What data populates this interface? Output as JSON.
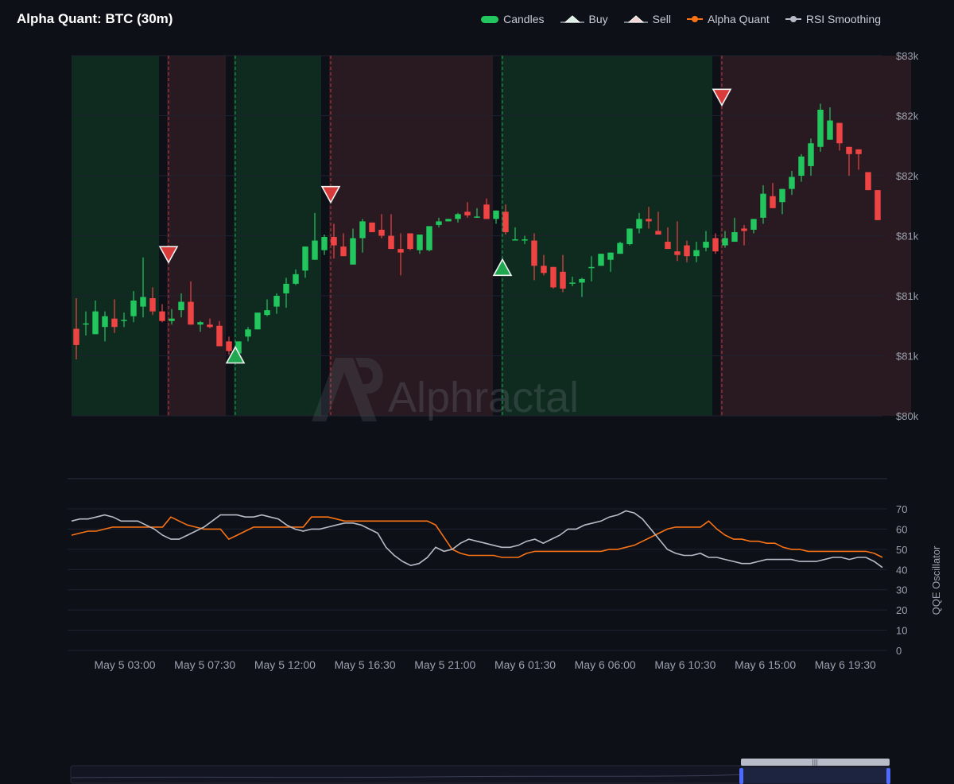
{
  "title": "Alpha Quant: BTC (30m)",
  "legend": [
    {
      "label": "Candles",
      "kind": "candle",
      "color": "#22c55e"
    },
    {
      "label": "Buy",
      "kind": "buy",
      "color": "#d7efe0"
    },
    {
      "label": "Sell",
      "kind": "sell",
      "color": "#f2d3d3"
    },
    {
      "label": "Alpha Quant",
      "kind": "line",
      "color": "#f97316"
    },
    {
      "label": "RSI Smoothing",
      "kind": "line",
      "color": "#b7bcc7"
    }
  ],
  "watermark": "Alphractal",
  "colors": {
    "up": "#22c55e",
    "down": "#ef4444",
    "bull_zone": "#0f2a1f",
    "bear_zone": "#281a20",
    "alpha_quant": "#f97316",
    "rsi": "#b7bcc7",
    "grid": "#1e2230",
    "axis_text": "#9aa0ad"
  },
  "chart_data": [
    {
      "type": "candlestick",
      "title": "Alpha Quant: BTC (30m)",
      "series": [
        {
          "name": "Candles"
        }
      ],
      "y_axis": {
        "min": 80000,
        "max": 83000,
        "ticks": [
          80000,
          80500,
          81000,
          81500,
          82000,
          82500,
          83000
        ],
        "tick_labels": [
          "$80k",
          "$81k",
          "$81k",
          "$81k",
          "$82k",
          "$82k",
          "$83k"
        ],
        "position": "right",
        "grid": true
      },
      "x_axis": {
        "tick_labels": [
          "May 5 03:00",
          "May 5 07:30",
          "May 5 12:00",
          "May 5 16:30",
          "May 5 21:00",
          "May 6 01:30",
          "May 6 06:00",
          "May 6 10:30",
          "May 6 15:00",
          "May 6 19:30"
        ]
      },
      "candles": [
        [
          80725,
          80980,
          80470,
          80590
        ],
        [
          80770,
          80870,
          80670,
          80770
        ],
        [
          80680,
          80960,
          80690,
          80870
        ],
        [
          80740,
          80870,
          80620,
          80830
        ],
        [
          80810,
          80970,
          80690,
          80740
        ],
        [
          80800,
          80860,
          80740,
          80800
        ],
        [
          80830,
          81040,
          80780,
          80960
        ],
        [
          80910,
          81320,
          80820,
          80990
        ],
        [
          80980,
          81070,
          80840,
          80870
        ],
        [
          80870,
          80930,
          80780,
          80790
        ],
        [
          80790,
          80890,
          80760,
          80810
        ],
        [
          80880,
          81020,
          80820,
          80950
        ],
        [
          80950,
          81120,
          80770,
          80760
        ],
        [
          80760,
          80790,
          80700,
          80780
        ],
        [
          80760,
          80810,
          80730,
          80740
        ],
        [
          80750,
          80790,
          80580,
          80580
        ],
        [
          80620,
          80660,
          80510,
          80540
        ],
        [
          80520,
          80620,
          80540,
          80620
        ],
        [
          80660,
          80740,
          80620,
          80720
        ],
        [
          80720,
          80840,
          80740,
          80860
        ],
        [
          80840,
          80970,
          80830,
          80880
        ],
        [
          80910,
          81020,
          80850,
          81000
        ],
        [
          81020,
          81150,
          80900,
          81100
        ],
        [
          81100,
          81220,
          81090,
          81180
        ],
        [
          81210,
          81360,
          81150,
          81410
        ],
        [
          81300,
          81690,
          81300,
          81460
        ],
        [
          81380,
          81510,
          81340,
          81490
        ],
        [
          81490,
          81600,
          81310,
          81420
        ],
        [
          81410,
          81520,
          81350,
          81330
        ],
        [
          81260,
          81560,
          81300,
          81480
        ],
        [
          81480,
          81640,
          81360,
          81620
        ],
        [
          81610,
          81600,
          81530,
          81530
        ],
        [
          81550,
          81680,
          81480,
          81500
        ],
        [
          81500,
          81680,
          81410,
          81390
        ],
        [
          81390,
          81520,
          81170,
          81360
        ],
        [
          81520,
          81490,
          81380,
          81390
        ],
        [
          81380,
          81510,
          81350,
          81510
        ],
        [
          81380,
          81520,
          81370,
          81580
        ],
        [
          81590,
          81650,
          81570,
          81620
        ],
        [
          81620,
          81560,
          81640,
          81640
        ],
        [
          81640,
          81690,
          81610,
          81680
        ],
        [
          81700,
          81780,
          81650,
          81670
        ],
        [
          81660,
          81730,
          81650,
          81660
        ],
        [
          81760,
          81810,
          81660,
          81640
        ],
        [
          81640,
          81690,
          81600,
          81710
        ],
        [
          81700,
          81760,
          81510,
          81530
        ],
        [
          81470,
          81570,
          81500,
          81470
        ],
        [
          81470,
          81500,
          81430,
          81470
        ],
        [
          81460,
          81520,
          81130,
          81250
        ],
        [
          81250,
          81340,
          81170,
          81190
        ],
        [
          81240,
          81070,
          81060,
          81070
        ],
        [
          81200,
          81340,
          81030,
          81060
        ],
        [
          81110,
          81160,
          81080,
          81110
        ],
        [
          81110,
          81150,
          80990,
          81140
        ],
        [
          81240,
          81330,
          81120,
          81240
        ],
        [
          81250,
          81320,
          81250,
          81350
        ],
        [
          81300,
          81330,
          81200,
          81360
        ],
        [
          81350,
          81450,
          81380,
          81440
        ],
        [
          81430,
          81510,
          81420,
          81560
        ],
        [
          81560,
          81690,
          81520,
          81640
        ],
        [
          81640,
          81740,
          81560,
          81620
        ],
        [
          81540,
          81700,
          81520,
          81510
        ],
        [
          81450,
          81570,
          81420,
          81390
        ],
        [
          81370,
          81620,
          81290,
          81340
        ],
        [
          81420,
          81460,
          81280,
          81330
        ],
        [
          81330,
          81450,
          81280,
          81380
        ],
        [
          81400,
          81540,
          81370,
          81450
        ],
        [
          81480,
          81520,
          81350,
          81370
        ],
        [
          81420,
          81540,
          81400,
          81480
        ],
        [
          81450,
          81650,
          81480,
          81530
        ],
        [
          81560,
          81590,
          81420,
          81540
        ],
        [
          81550,
          81590,
          81520,
          81640
        ],
        [
          81650,
          81920,
          81600,
          81850
        ],
        [
          81830,
          81940,
          81730,
          81730
        ],
        [
          81780,
          81880,
          81680,
          81890
        ],
        [
          81890,
          82040,
          81840,
          81990
        ],
        [
          82000,
          82180,
          81950,
          82160
        ],
        [
          82080,
          82310,
          82000,
          82270
        ],
        [
          82240,
          82600,
          82200,
          82550
        ],
        [
          82300,
          82570,
          82330,
          82460
        ],
        [
          82440,
          82360,
          82210,
          82270
        ],
        [
          82240,
          82200,
          82000,
          82180
        ],
        [
          82220,
          82100,
          82050,
          82180
        ],
        [
          82030,
          81840,
          81910,
          81880
        ],
        [
          81880,
          81820,
          81690,
          81630
        ]
      ],
      "signals": [
        {
          "type": "sell",
          "index": 10,
          "price": 81350
        },
        {
          "type": "buy",
          "index": 17,
          "price": 80500
        },
        {
          "type": "sell",
          "index": 27,
          "price": 81850
        },
        {
          "type": "buy",
          "index": 45,
          "price": 81230
        },
        {
          "type": "sell",
          "index": 68,
          "price": 82660
        }
      ],
      "zones": [
        {
          "kind": "bull",
          "from": 0,
          "to": 9
        },
        {
          "kind": "bear",
          "from": 10,
          "to": 16
        },
        {
          "kind": "bull",
          "from": 17,
          "to": 26
        },
        {
          "kind": "bear",
          "from": 27,
          "to": 44
        },
        {
          "kind": "bull",
          "from": 45,
          "to": 67
        },
        {
          "kind": "bear",
          "from": 68,
          "to": 87
        }
      ]
    },
    {
      "type": "line",
      "y_axis": {
        "label": "QQE Oscillator",
        "min": 0,
        "max": 70,
        "ticks": [
          0,
          10,
          20,
          30,
          40,
          50,
          60,
          70
        ],
        "grid": true,
        "position": "right"
      },
      "series": [
        {
          "name": "Alpha Quant",
          "color": "#f97316",
          "values": [
            57,
            58,
            59,
            59,
            60,
            61,
            61,
            61,
            61,
            61,
            61,
            61,
            66,
            64,
            62,
            61,
            60,
            60,
            60,
            55,
            57,
            59,
            61,
            61,
            61,
            61,
            61,
            61,
            61,
            66,
            66,
            66,
            65,
            64,
            64,
            64,
            64,
            64,
            64,
            64,
            64,
            64,
            64,
            64,
            62,
            56,
            50,
            48,
            47,
            47,
            47,
            47,
            46,
            46,
            46,
            48,
            49,
            49,
            49,
            49,
            49,
            49,
            49,
            49,
            49,
            50,
            50,
            51,
            52,
            54,
            56,
            58,
            60,
            61,
            61,
            61,
            61,
            64,
            60,
            57,
            55,
            55,
            54,
            54,
            53,
            53,
            51,
            50,
            50,
            49,
            49,
            49,
            49,
            49,
            49,
            49,
            49,
            48,
            46
          ]
        },
        {
          "name": "RSI Smoothing",
          "color": "#b7bcc7",
          "values": [
            64,
            65,
            65,
            66,
            67,
            66,
            64,
            64,
            64,
            62,
            60,
            57,
            55,
            55,
            57,
            59,
            61,
            64,
            67,
            67,
            67,
            66,
            66,
            67,
            66,
            65,
            62,
            60,
            59,
            60,
            60,
            61,
            62,
            63,
            63,
            62,
            60,
            58,
            51,
            47,
            44,
            42,
            43,
            46,
            51,
            49,
            50,
            53,
            55,
            54,
            53,
            52,
            51,
            51,
            52,
            54,
            55,
            53,
            55,
            57,
            60,
            60,
            62,
            63,
            64,
            66,
            67,
            69,
            68,
            65,
            60,
            55,
            50,
            48,
            47,
            47,
            48,
            46,
            46,
            45,
            44,
            43,
            43,
            44,
            45,
            45,
            45,
            45,
            44,
            44,
            44,
            45,
            46,
            46,
            45,
            46,
            46,
            44,
            41
          ]
        }
      ]
    }
  ]
}
